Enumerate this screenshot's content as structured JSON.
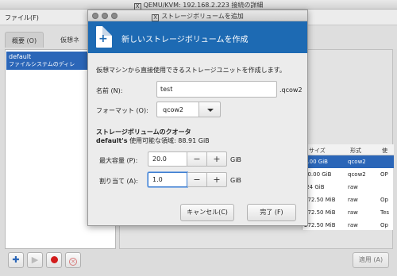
{
  "background_window": {
    "title": "QEMU/KVM: 192.168.2.223 接続の詳細",
    "menu_file": "ファイル(F)",
    "tabs": [
      "概要 (O)",
      "仮想ネ"
    ],
    "pool": {
      "name": "default",
      "description": "ファイルシステムのディレ"
    },
    "table": {
      "headers": [
        "サイズ",
        "形式",
        "使"
      ],
      "rows": [
        {
          "size": "0.00 GiB",
          "format": "qcow2",
          "extra": ""
        },
        {
          "size": "20.00 GiB",
          "format": "qcow2",
          "extra": "OP"
        },
        {
          "size": ".24 GiB",
          "format": "raw",
          "extra": ""
        },
        {
          "size": "272.50 MiB",
          "format": "raw",
          "extra": "Op"
        },
        {
          "size": "272.50 MiB",
          "format": "raw",
          "extra": "Tes"
        },
        {
          "size": "272.50 MiB",
          "format": "raw",
          "extra": "Op"
        }
      ]
    },
    "apply_label": "適用 (A)"
  },
  "dialog": {
    "title": "ストレージボリュームを追加",
    "header_title": "新しいストレージボリュームを作成",
    "description": "仮想マシンから直接使用できるストレージユニットを作成します。",
    "name_label": "名前 (N):",
    "name_value": "test",
    "name_suffix": ".qcow2",
    "format_label": "フォーマット (O):",
    "format_value": "qcow2",
    "quota_heading": "ストレージボリュームのクオータ",
    "available_bold": "default's",
    "available_rest": "使用可能な領域: 88.91 GiB",
    "max_capacity_label": "最大容量 (P):",
    "max_capacity_value": "20.0",
    "allocation_label": "割り当て (A):",
    "allocation_value": "1.0",
    "unit": "GiB",
    "minus": "−",
    "plus": "+",
    "cancel_label": "キャンセル(C)",
    "finish_label": "完了 (F)"
  },
  "colors": {
    "accent": "#1d6ab3",
    "selection": "#2b66b8"
  }
}
